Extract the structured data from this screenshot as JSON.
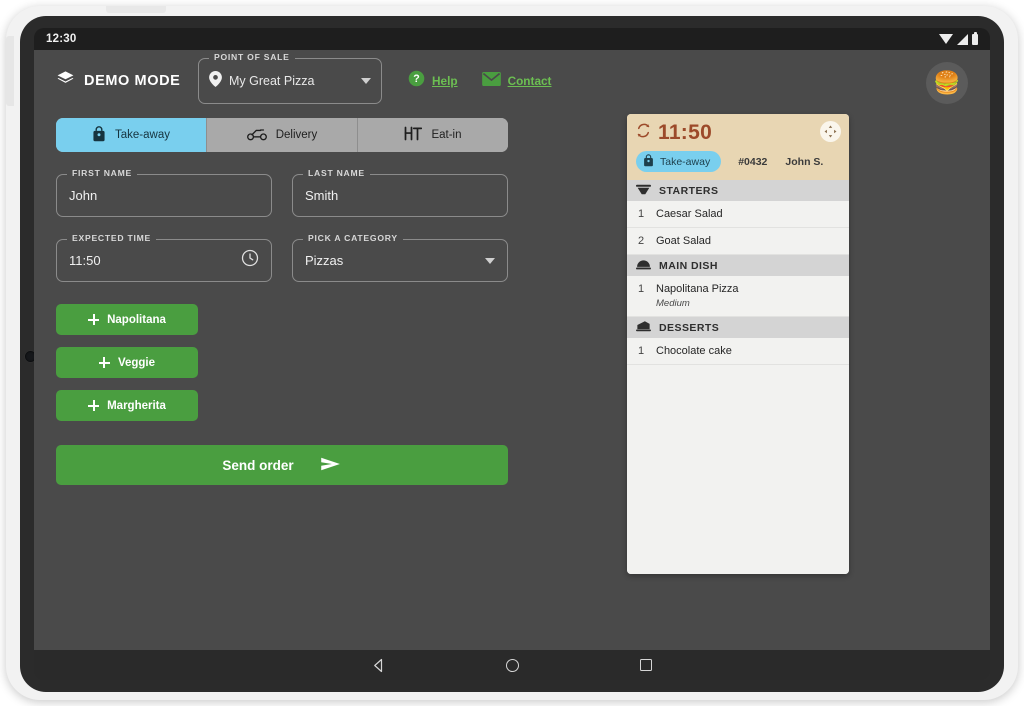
{
  "status_bar": {
    "clock": "12:30",
    "icons": [
      "wifi-icon",
      "signal-icon",
      "battery-icon"
    ]
  },
  "topbar": {
    "brand_icon": "layers-icon",
    "brand_label": "DEMO MODE",
    "point_of_sale": {
      "legend": "POINT OF SALE",
      "location_icon": "map-pin-icon",
      "value": "My Great Pizza",
      "caret_icon": "chevron-down-icon"
    },
    "links": [
      {
        "icon": "question-circle-icon",
        "label": "Help"
      },
      {
        "icon": "envelope-icon",
        "label": "Contact"
      }
    ],
    "avatar": {
      "icon": "burger-avatar",
      "glyph": "🍔"
    }
  },
  "tabs": [
    {
      "id": "take-away",
      "label": "Take-away",
      "icon": "shopping-bag-icon",
      "active": true
    },
    {
      "id": "delivery",
      "label": "Delivery",
      "icon": "scooter-icon",
      "active": false
    },
    {
      "id": "eat-in",
      "label": "Eat-in",
      "icon": "table-icon",
      "active": false
    }
  ],
  "form": {
    "first_name": {
      "legend": "FIRST NAME",
      "value": "John"
    },
    "last_name": {
      "legend": "LAST NAME",
      "value": "Smith"
    },
    "expected_time": {
      "legend": "EXPECTED TIME",
      "value": "11:50",
      "icon": "clock-icon"
    },
    "category": {
      "legend": "PICK A CATEGORY",
      "value": "Pizzas",
      "icon": "chevron-down-icon"
    }
  },
  "products": [
    {
      "label": "Napolitana"
    },
    {
      "label": "Veggie"
    },
    {
      "label": "Margherita"
    }
  ],
  "send_order": {
    "label": "Send order",
    "icon": "send-arrow-icon"
  },
  "ticket": {
    "time": "11:50",
    "refresh_icon": "refresh-icon",
    "move_icon": "move-handle-icon",
    "chip": {
      "label": "Take-away",
      "icon": "shopping-bag-icon"
    },
    "order_number": "#0432",
    "customer": "John S.",
    "sections": [
      {
        "title": "STARTERS",
        "icon": "bowl-icon",
        "items": [
          {
            "qty": "1",
            "name": "Caesar Salad",
            "option": ""
          },
          {
            "qty": "2",
            "name": "Goat Salad",
            "option": ""
          }
        ]
      },
      {
        "title": "MAIN DISH",
        "icon": "cloche-icon",
        "items": [
          {
            "qty": "1",
            "name": "Napolitana Pizza",
            "option": "Medium"
          }
        ]
      },
      {
        "title": "DESSERTS",
        "icon": "cake-slice-icon",
        "items": [
          {
            "qty": "1",
            "name": "Chocolate cake",
            "option": ""
          }
        ]
      }
    ]
  },
  "navbar": {
    "back": "back-button",
    "home": "home-button",
    "recents": "recents-button"
  },
  "colors": {
    "app_bg": "#4a4a4a",
    "accent_green": "#4a9e40",
    "link_green": "#6cbf52",
    "tab_active": "#79cfee",
    "ticket_head": "#e8d6b3",
    "ticket_time": "#9c4a2a"
  }
}
